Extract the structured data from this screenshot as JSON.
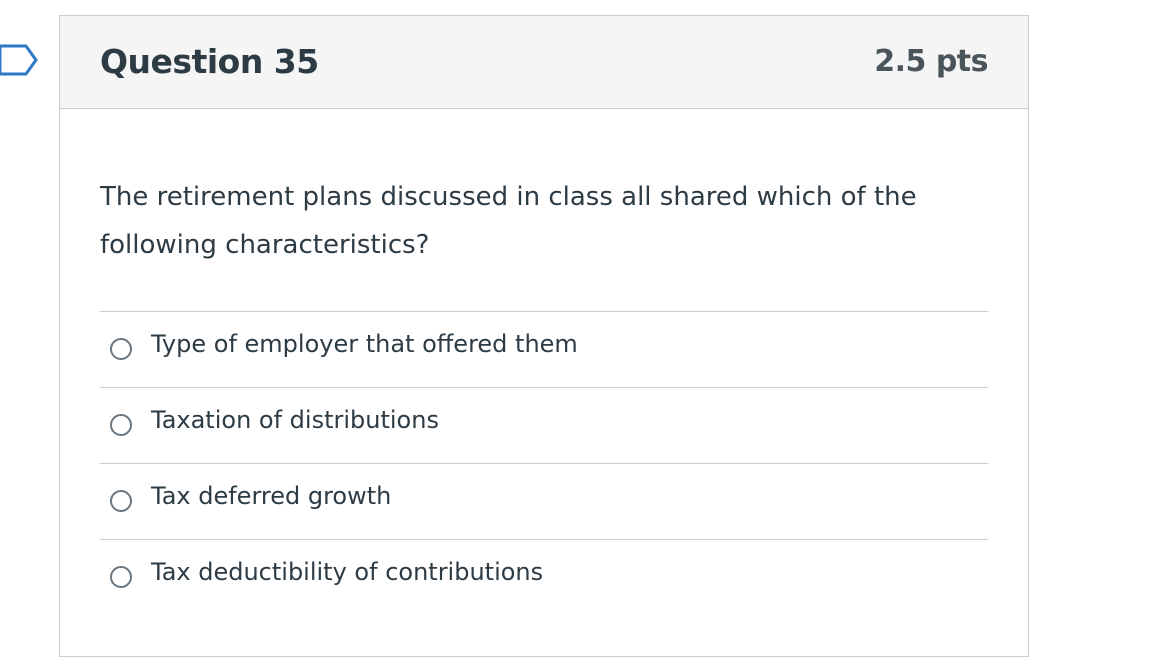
{
  "question": {
    "title": "Question 35",
    "points": "2.5 pts",
    "text": "The retirement plans discussed in class all shared which of the following characteristics?",
    "answers": [
      {
        "label": "Type of employer that offered them",
        "selected": false
      },
      {
        "label": "Taxation of distributions",
        "selected": false
      },
      {
        "label": "Tax deferred growth",
        "selected": false
      },
      {
        "label": "Tax deductibility of contributions",
        "selected": false
      }
    ]
  },
  "colors": {
    "flag": "#2d78c8",
    "header_bg": "#f5f5f5",
    "border": "#c7cdd1",
    "text": "#2d3b45"
  },
  "icons": {
    "flag": "flag-question-icon"
  }
}
